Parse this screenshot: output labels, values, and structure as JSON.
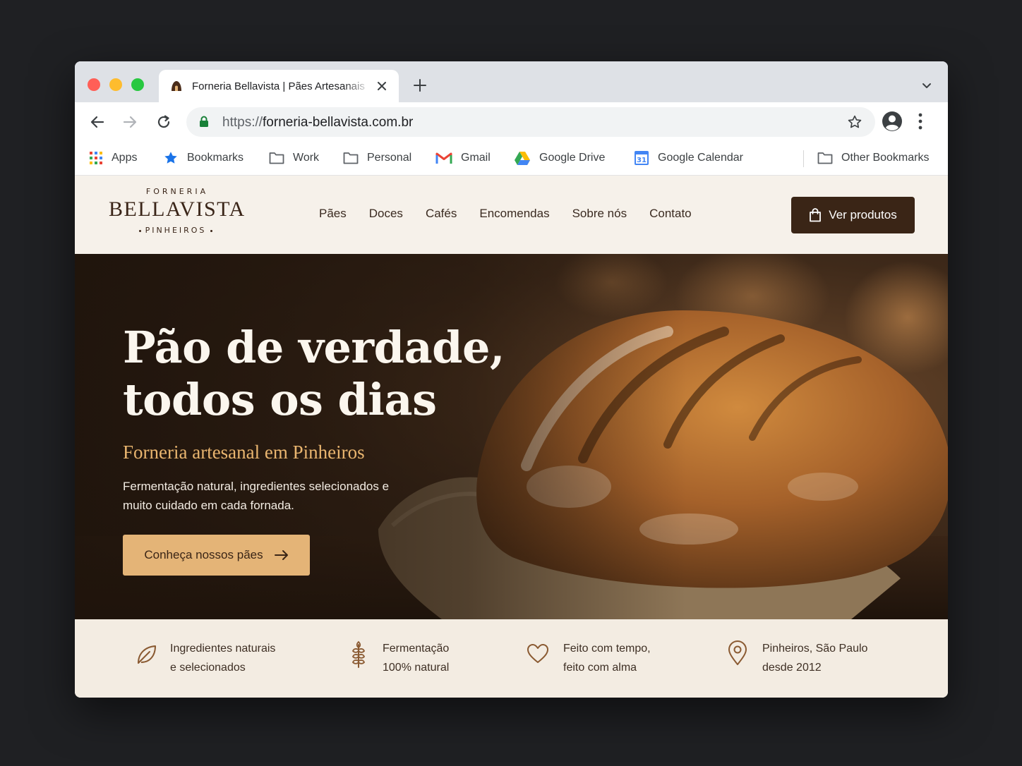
{
  "browser": {
    "tab_title": "Forneria Bellavista | Pães Artesanais",
    "url_scheme": "https://",
    "url_host": "forneria-bellavista.com.br",
    "bookmarks": [
      {
        "label": "Apps",
        "icon": "apps-grid-icon"
      },
      {
        "label": "Bookmarks",
        "icon": "star-icon"
      },
      {
        "label": "Work",
        "icon": "folder-icon"
      },
      {
        "label": "Personal",
        "icon": "folder-icon"
      },
      {
        "label": "Gmail",
        "icon": "gmail-icon"
      },
      {
        "label": "Google Drive",
        "icon": "google-drive-icon"
      },
      {
        "label": "Google Calendar",
        "icon": "google-calendar-icon"
      },
      {
        "label": "Other Bookmarks",
        "icon": "folder-icon"
      }
    ],
    "calendar_icon_day": "31"
  },
  "site": {
    "logo": {
      "top": "FORNERIA",
      "main": "BELLAVISTA",
      "bottom": "PINHEIROS"
    },
    "nav": [
      "Pães",
      "Doces",
      "Cafés",
      "Encomendas",
      "Sobre nós",
      "Contato"
    ],
    "cta_products": "Ver produtos",
    "hero": {
      "title_line1": "Pão de verdade,",
      "title_line2": "todos os dias",
      "subtitle": "Forneria artesanal em Pinheiros",
      "description": "Fermentação natural, ingredientes selecionados e muito cuidado em cada fornada.",
      "cta": "Conheça nossos pães"
    },
    "features": [
      {
        "line1": "Ingredientes naturais",
        "line2": "e selecionados",
        "icon": "leaf-icon"
      },
      {
        "line1": "Fermentação",
        "line2": "100% natural",
        "icon": "wheat-icon"
      },
      {
        "line1": "Feito com tempo,",
        "line2": "feito com alma",
        "icon": "heart-icon"
      },
      {
        "line1": "Pinheiros, São Paulo",
        "line2": "desde 2012",
        "icon": "map-pin-icon"
      }
    ]
  },
  "colors": {
    "brand_dark": "#3a2516",
    "accent_gold": "#e4b477",
    "header_bg": "#f6f1ea",
    "features_bg": "#f3ece2"
  }
}
